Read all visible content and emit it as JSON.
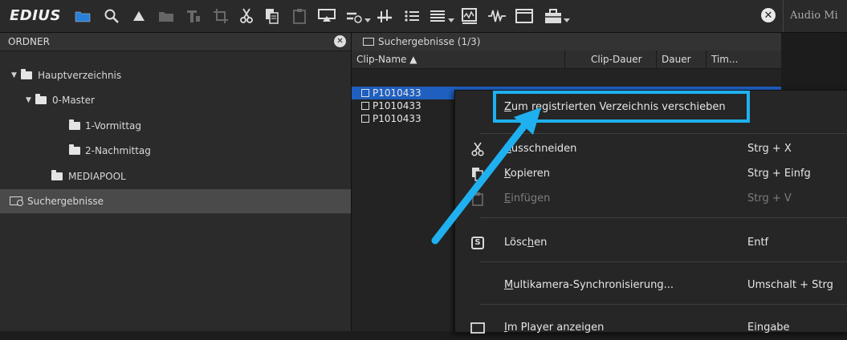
{
  "app": {
    "name": "EDIUS",
    "audio_tab_label": "Audio Mi"
  },
  "toolbar": {
    "icons": [
      "folder-icon",
      "search-icon",
      "up-arrow-icon",
      "open-folder-icon",
      "text-icon",
      "crop-icon",
      "cut-icon",
      "copy-icon",
      "paste-icon",
      "export-icon",
      "add-track-icon",
      "clip-markers-icon",
      "list-view-icon",
      "details-view-icon",
      "waveform-icon",
      "filter-icon",
      "window-icon",
      "toolbox-icon",
      "close-icon"
    ]
  },
  "left_panel": {
    "title": "ORDNER",
    "tree": [
      {
        "label": "Hauptverzeichnis"
      },
      {
        "label": "0-Master"
      },
      {
        "label": "1-Vormittag"
      },
      {
        "label": "2-Nachmittag"
      },
      {
        "label": "MEDIAPOOL"
      },
      {
        "label": "Suchergebnisse"
      }
    ]
  },
  "right_panel": {
    "title": "Suchergebnisse (1/3)",
    "columns": [
      "Clip-Name ▲",
      "Clip-Dauer",
      "Dauer",
      "Tim..."
    ],
    "clips": [
      "P1010433",
      "P1010433",
      "P1010433"
    ]
  },
  "context_menu": {
    "items": [
      {
        "label": "Zum registrierten Verzeichnis verschieben",
        "underline": "Z",
        "rest": "um registrierten Verzeichnis verschieben",
        "shortcut": "",
        "icon": "",
        "enabled": true
      },
      {
        "label": "Ausschneiden",
        "underline": "A",
        "rest": "usschneiden",
        "shortcut": "Strg + X",
        "icon": "scissors-icon",
        "enabled": true
      },
      {
        "label": "Kopieren",
        "underline": "K",
        "rest": "opieren",
        "shortcut": "Strg + Einfg",
        "icon": "copy-icon",
        "enabled": true
      },
      {
        "label": "Einfügen",
        "underline": "E",
        "rest": "infügen",
        "shortcut": "Strg + V",
        "icon": "paste-icon",
        "enabled": false
      },
      {
        "label": "Löschen",
        "pre": "Lösc",
        "underline": "h",
        "rest": "en",
        "shortcut": "Entf",
        "icon": "delete-icon",
        "enabled": true
      },
      {
        "label": "Multikamera-Synchronisierung...",
        "underline": "M",
        "rest": "ultikamera-Synchronisierung...",
        "shortcut": "Umschalt + Strg",
        "icon": "",
        "enabled": true
      },
      {
        "label": "Im Player anzeigen",
        "underline": "I",
        "rest": "m Player anzeigen",
        "shortcut": "Eingabe",
        "icon": "player-icon",
        "enabled": true
      }
    ]
  },
  "annotation": {
    "highlight_color": "#1fb0f0"
  }
}
